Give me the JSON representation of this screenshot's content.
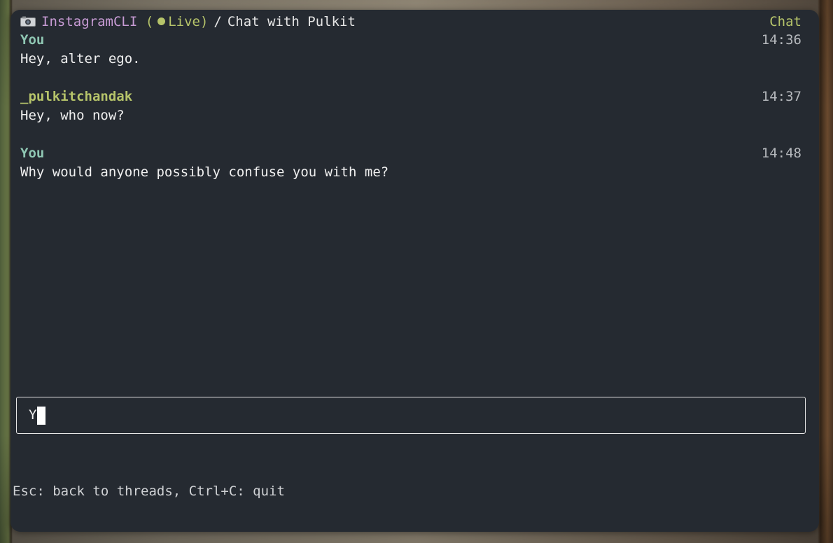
{
  "header": {
    "app_name": "InstagramCLI",
    "status_open": "(",
    "status_label": "Live",
    "status_close": ")",
    "separator": "/",
    "chat_title": "Chat with Pulkit",
    "mode": "Chat"
  },
  "messages": [
    {
      "sender": "You",
      "time": "14:36",
      "text": "Hey, alter ego."
    },
    {
      "sender": "_pulkitchandak",
      "time": "14:37",
      "text": "Hey, who now?"
    },
    {
      "sender": "You",
      "time": "14:48",
      "text": "Why would anyone possibly confuse you with me?"
    }
  ],
  "input": {
    "value": "Y"
  },
  "footer": {
    "help": "Esc: back to threads, Ctrl+C: quit"
  },
  "icons": {
    "camera": "camera-icon",
    "live": "live-dot-icon"
  },
  "colors": {
    "background": "#252a31",
    "app_name": "#c79bd4",
    "accent": "#b6c46a",
    "you": "#8fc7b3"
  }
}
